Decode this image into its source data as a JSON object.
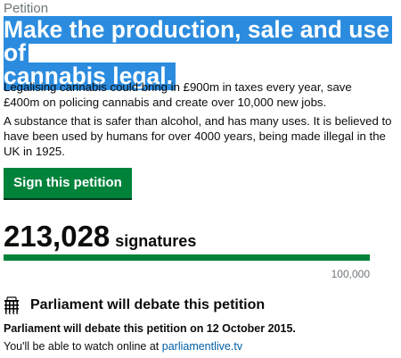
{
  "eyebrow": "Petition",
  "title": {
    "line1": "Make the production, sale and use of",
    "line2": "cannabis legal."
  },
  "summary": "Legalising cannabis could bring in £900m in taxes every year, save £400m on policing cannabis and create over 10,000 new jobs.",
  "details": "A substance that is safer than alcohol, and has many uses. It is believed to have been used by humans for over 4000 years, being made illegal in the UK in 1925.",
  "sign_button": "Sign this petition",
  "signatures": {
    "count": "213,028",
    "label": "signatures",
    "goal": "100,000",
    "progress_fraction": 1.0
  },
  "debate": {
    "heading": "Parliament will debate this petition",
    "date_text": "Parliament will debate this petition on 12 October 2015.",
    "watch_prefix": "You'll be able to watch online at ",
    "watch_link": "parliamentlive.tv"
  },
  "colors": {
    "title_highlight": "#2b8cdf",
    "button_green": "#00823b",
    "link_blue": "#005ea5"
  },
  "icons": {
    "debate_icon": "portcullis-icon"
  }
}
